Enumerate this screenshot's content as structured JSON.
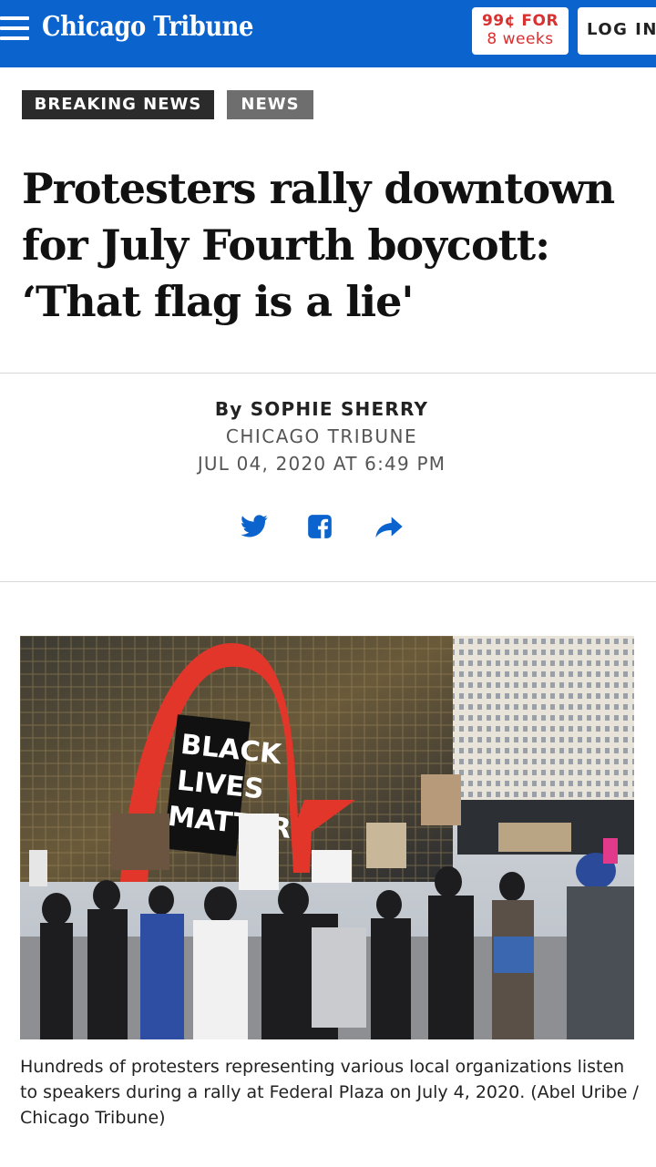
{
  "header": {
    "logo": "Chicago Tribune",
    "subscribe_line1": "99¢ FOR",
    "subscribe_line2": "8 weeks",
    "login": "LOG IN",
    "colors": {
      "bar": "#0b63ce",
      "subscribe_text": "#d93030"
    }
  },
  "tags": {
    "breaking": "BREAKING NEWS",
    "news": "NEWS"
  },
  "article": {
    "headline": "Protesters rally downtown for July Fourth boycott: ‘That flag is a lie'",
    "byline": "By SOPHIE SHERRY",
    "source": "CHICAGO TRIBUNE",
    "date": "JUL 04, 2020 AT 6:49 PM"
  },
  "share": {
    "icons": [
      "twitter-icon",
      "facebook-icon",
      "share-forward-icon"
    ],
    "color": "#0b63ce"
  },
  "photo": {
    "sign_words": [
      "BLACK",
      "LIVES",
      "MATTER"
    ],
    "caption": "Hundreds of protesters representing various local organizations listen to speakers during a rally at Federal Plaza on July 4, 2020. (Abel Uribe / Chicago Tribune)"
  }
}
